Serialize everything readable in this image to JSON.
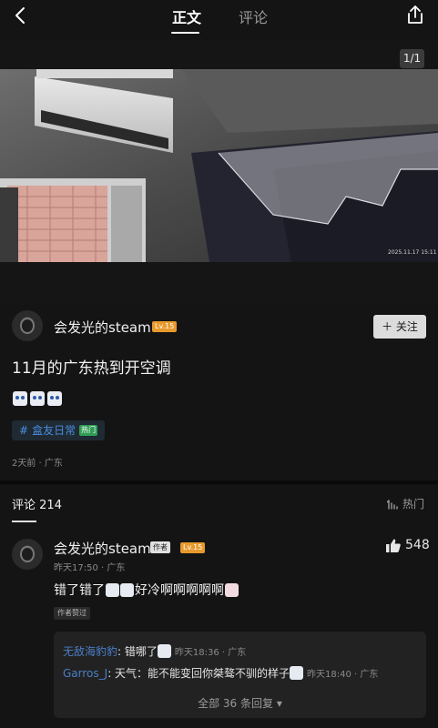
{
  "header": {
    "tab_main": "正文",
    "tab_comment": "评论",
    "back_icon": "chevron-left-icon",
    "share_icon": "share-icon"
  },
  "media": {
    "counter": "1/1",
    "stamp": "2025.11.17  15:11"
  },
  "post": {
    "author": "会发光的steam",
    "level": "Lv.15",
    "follow_label": "关注",
    "title": "11月的广东热到开空调",
    "tag_label": "盒友日常",
    "tag_badge": "热门",
    "meta": "2天前 · 广东"
  },
  "comments": {
    "title": "评论",
    "count": "214",
    "sort_label": "热门",
    "items": [
      {
        "author": "会发光的steam",
        "author_badge": "作者",
        "level": "Lv.15",
        "likes": "548",
        "meta": "昨天17:50 · 广东",
        "body_a": "错了错了",
        "body_b": "好冷啊啊啊啊啊",
        "praise": "作者赞过",
        "replies": [
          {
            "name": "无敌海豹豹",
            "text": ": 错哪了",
            "time": "昨天18:36 · 广东"
          },
          {
            "name": "Garros_J",
            "text": ": 天气：能不能变回你桀骜不驯的样子",
            "time": "昨天18:40 · 广东"
          }
        ],
        "more_replies": "全部 36 条回复"
      }
    ]
  },
  "colors": {
    "background": "#141414",
    "level_badge": "#e8992c",
    "tag_text": "#4a8de0",
    "hot_badge": "#2f9d55",
    "reply_name": "#4a7fc8"
  }
}
